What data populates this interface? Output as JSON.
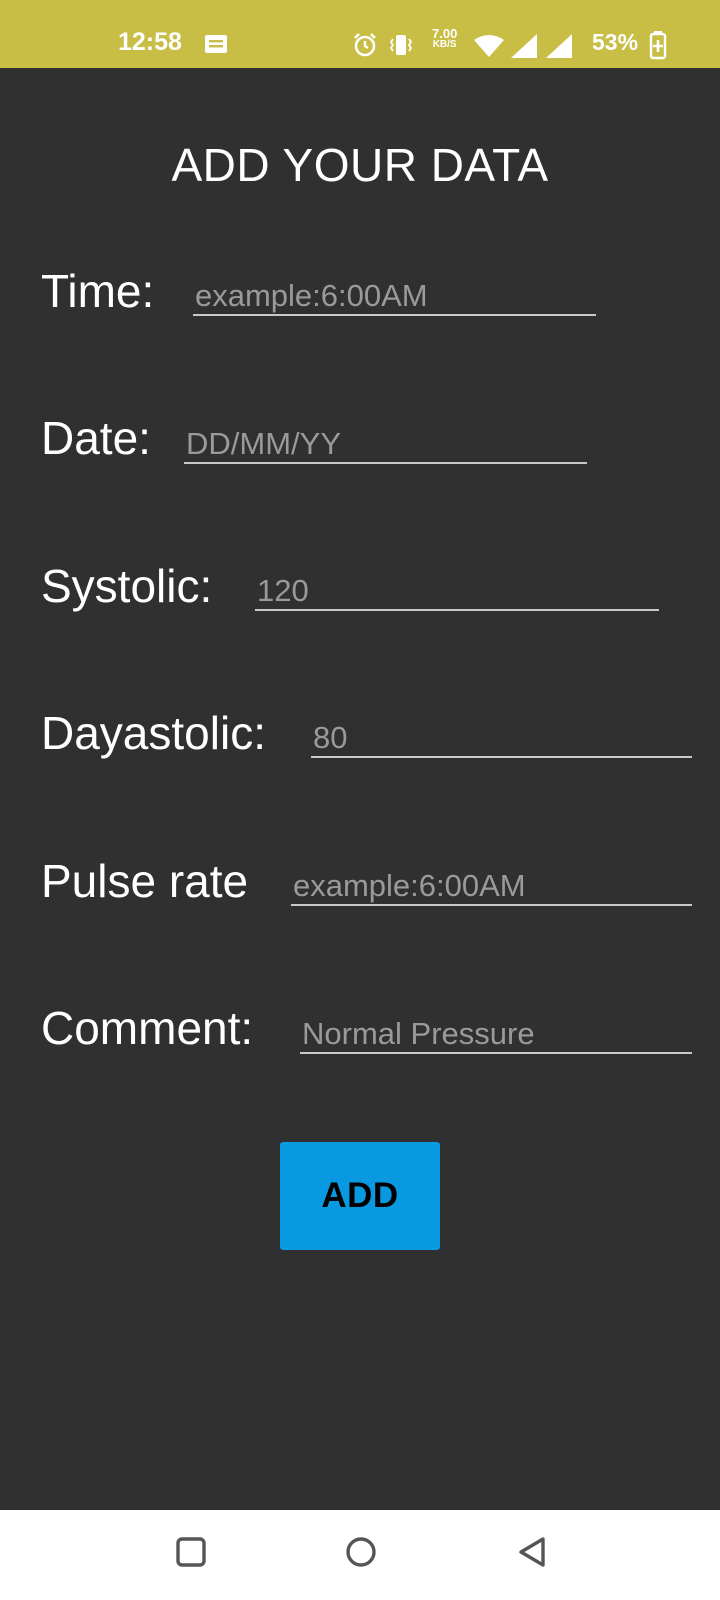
{
  "status_bar": {
    "time": "12:58",
    "net_speed_value": "7.00",
    "net_speed_unit": "KB/S",
    "battery_percent": "53%",
    "icons": [
      "notes-icon",
      "alarm-icon",
      "vibrate-icon",
      "wifi-icon",
      "signal-icon",
      "signal-icon",
      "battery-charging-icon"
    ],
    "bg_color": "#c8bd45"
  },
  "page": {
    "title": "ADD YOUR DATA",
    "bg_color": "#303030"
  },
  "form": {
    "time": {
      "label": "Time:",
      "placeholder": "example:6:00AM"
    },
    "date": {
      "label": "Date:",
      "placeholder": "DD/MM/YY"
    },
    "systolic": {
      "label": "Systolic:",
      "placeholder": "120"
    },
    "diastolic": {
      "label": "Dayastolic:",
      "placeholder": "80"
    },
    "pulse_rate": {
      "label": "Pulse rate",
      "placeholder": "example:6:00AM"
    },
    "comment": {
      "label": "Comment:",
      "placeholder": "Normal Pressure"
    }
  },
  "add_button": {
    "label": "ADD",
    "color": "#0999e0"
  },
  "nav_bar": {
    "buttons": [
      "recents-square-icon",
      "home-circle-icon",
      "back-triangle-icon"
    ]
  }
}
